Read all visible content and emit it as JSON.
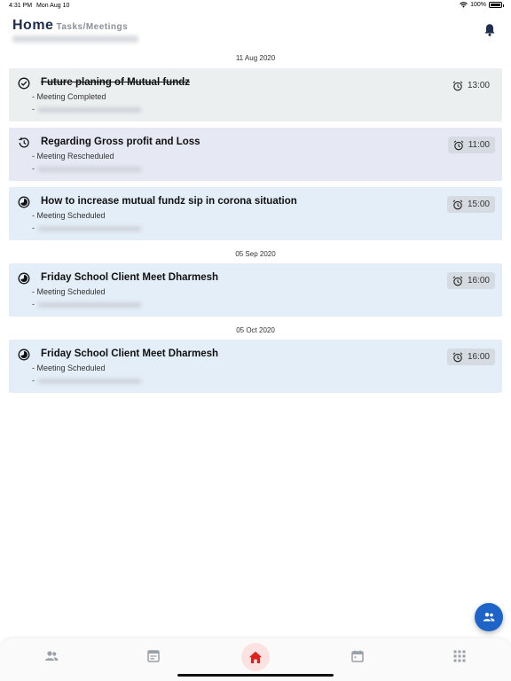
{
  "status_bar": {
    "time": "4:31 PM",
    "date": "Mon Aug 10",
    "battery": "100%"
  },
  "header": {
    "title": "Home",
    "subtitle": "Tasks/Meetings"
  },
  "date_groups": [
    {
      "date": "11 Aug 2020"
    },
    {
      "date": "05 Sep 2020"
    },
    {
      "date": "05 Oct 2020"
    }
  ],
  "meetings": [
    {
      "title": "Future planing of Mutual fundz",
      "status": "- Meeting Completed",
      "dash": "-",
      "time": "13:00",
      "icon": "check-circle-icon"
    },
    {
      "title": "Regarding Gross profit and Loss",
      "status": "- Meeting Rescheduled",
      "dash": "-",
      "time": "11:00",
      "icon": "history-icon"
    },
    {
      "title": "How to increase mutual fundz sip in corona situation",
      "status": "- Meeting Scheduled",
      "dash": "-",
      "time": "15:00",
      "icon": "half-circle-icon"
    },
    {
      "title": "Friday School Client Meet Dharmesh",
      "status": "- Meeting Scheduled",
      "dash": "-",
      "time": "16:00",
      "icon": "half-circle-icon"
    },
    {
      "title": "Friday School Client Meet Dharmesh",
      "status": "- Meeting Scheduled",
      "dash": "-",
      "time": "16:00",
      "icon": "half-circle-icon"
    }
  ],
  "colors": {
    "accent_blue": "#1e64c8",
    "home_red": "#e01f1f",
    "title_navy": "#1f2e4d"
  },
  "nav": {
    "items": [
      "people-icon",
      "notes-icon",
      "home-icon",
      "calendar-icon",
      "apps-icon"
    ],
    "active": "home-icon"
  }
}
